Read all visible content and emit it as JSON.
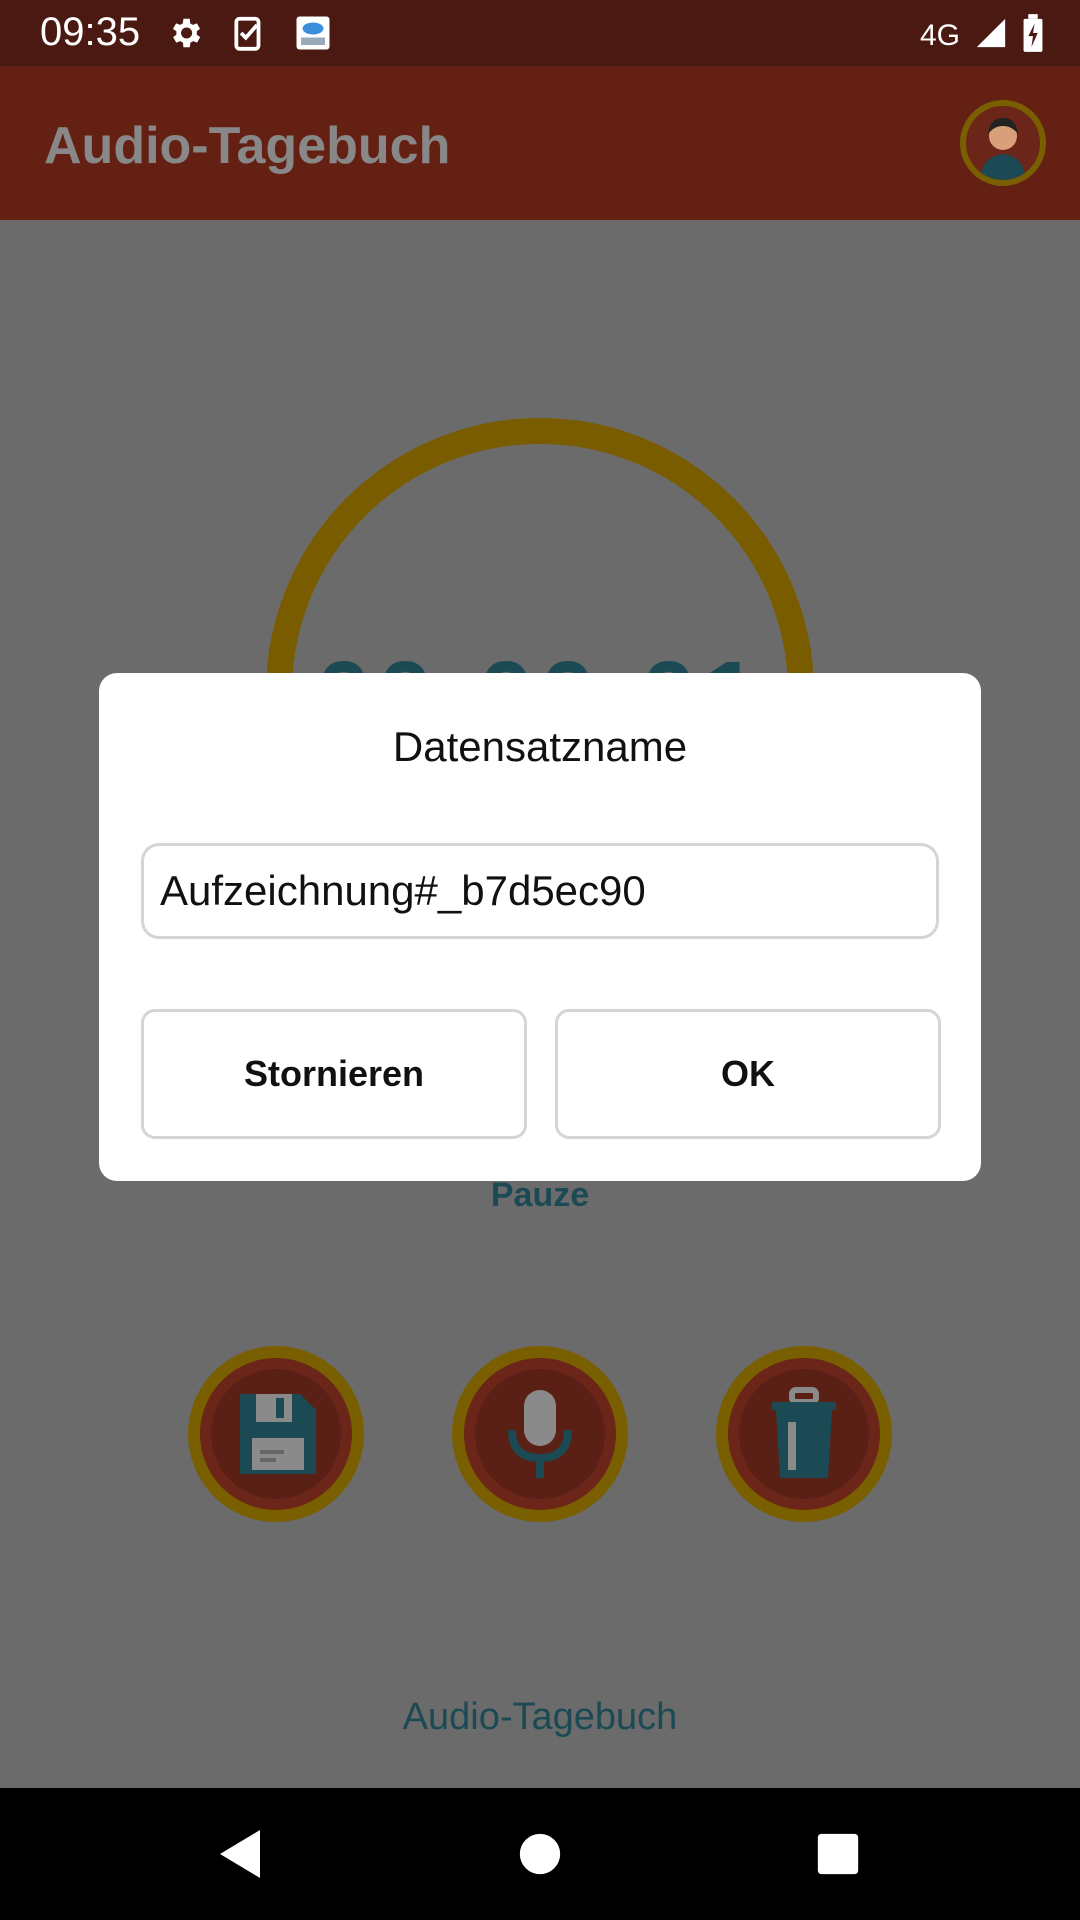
{
  "status_bar": {
    "time": "09:35",
    "icons_left": [
      "gear-icon",
      "clipboard-check-icon",
      "cloud-app-icon"
    ],
    "network": "4G",
    "icons_right": [
      "signal-icon",
      "battery-charging-icon"
    ]
  },
  "app_bar": {
    "title": "Audio-Tagebuch",
    "avatar": "user-avatar-icon"
  },
  "main": {
    "timer": "00:00:01",
    "status_label": "Pauze",
    "buttons": [
      {
        "name": "save",
        "icon": "floppy-disk-icon"
      },
      {
        "name": "record",
        "icon": "microphone-icon"
      },
      {
        "name": "delete",
        "icon": "trash-icon"
      }
    ],
    "footer": "Audio-Tagebuch"
  },
  "dialog": {
    "title": "Datensatzname",
    "input_value": "Aufzeichnung#_b7d5ec90",
    "cancel_label": "Stornieren",
    "ok_label": "OK"
  },
  "nav_bar": {
    "back": "back-triangle-icon",
    "home": "home-circle-icon",
    "recents": "recents-square-icon"
  },
  "colors": {
    "status_bar": "#4a1a12",
    "app_bar": "#652014",
    "overlay": "#6b6b6b",
    "ring": "#7a5c00",
    "button_fill": "#6b2519",
    "accent_teal": "#1b4a55"
  }
}
